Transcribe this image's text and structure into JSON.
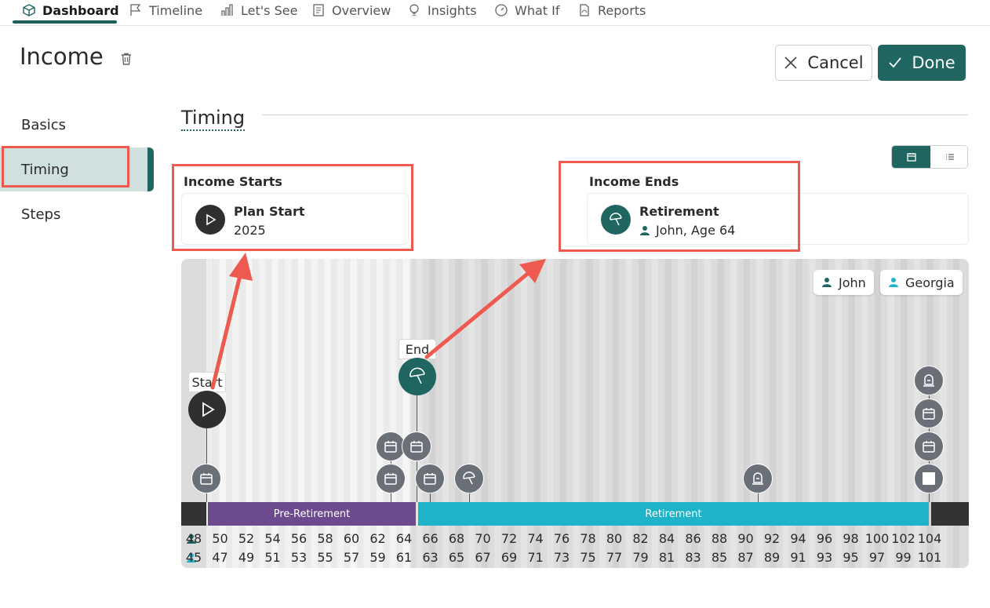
{
  "nav": {
    "tabs": [
      {
        "label": "Dashboard",
        "icon": "box-icon",
        "active": true
      },
      {
        "label": "Timeline",
        "icon": "flag-icon"
      },
      {
        "label": "Let's See",
        "icon": "bar-chart-icon"
      },
      {
        "label": "Overview",
        "icon": "document-icon"
      },
      {
        "label": "Insights",
        "icon": "lightbulb-icon"
      },
      {
        "label": "What If",
        "icon": "gauge-icon"
      },
      {
        "label": "Reports",
        "icon": "pdf-icon"
      }
    ]
  },
  "header": {
    "title": "Income",
    "cancel_label": "Cancel",
    "done_label": "Done"
  },
  "sidebar": {
    "items": [
      {
        "label": "Basics"
      },
      {
        "label": "Timing",
        "active": true
      },
      {
        "label": "Steps"
      }
    ]
  },
  "section": {
    "title": "Timing"
  },
  "income_starts": {
    "label": "Income Starts",
    "title": "Plan Start",
    "subtitle": "2025"
  },
  "income_ends": {
    "label": "Income Ends",
    "title": "Retirement",
    "subtitle": "John, Age 64"
  },
  "timeline": {
    "people": [
      {
        "name": "John",
        "color": "#1f6560"
      },
      {
        "name": "Georgia",
        "color": "#1fb3c9"
      }
    ],
    "start_tag": "Start",
    "end_tag": "End",
    "phases": [
      {
        "label": "Pre-Retirement",
        "color": "#6b4a8e"
      },
      {
        "label": "Retirement",
        "color": "#1fb3c9"
      }
    ],
    "john_ages": [
      "48",
      "50",
      "52",
      "54",
      "56",
      "58",
      "60",
      "62",
      "64",
      "66",
      "68",
      "70",
      "72",
      "74",
      "76",
      "78",
      "80",
      "82",
      "84",
      "86",
      "88",
      "90",
      "92",
      "94",
      "96",
      "98",
      "100",
      "102",
      "104"
    ],
    "georgia_ages": [
      "45",
      "47",
      "49",
      "51",
      "53",
      "55",
      "57",
      "59",
      "61",
      "63",
      "65",
      "67",
      "69",
      "71",
      "73",
      "75",
      "77",
      "79",
      "81",
      "83",
      "85",
      "87",
      "89",
      "91",
      "93",
      "95",
      "97",
      "99",
      "101"
    ]
  },
  "colors": {
    "accent": "#1f6560",
    "highlight": "#ee5a4f"
  }
}
